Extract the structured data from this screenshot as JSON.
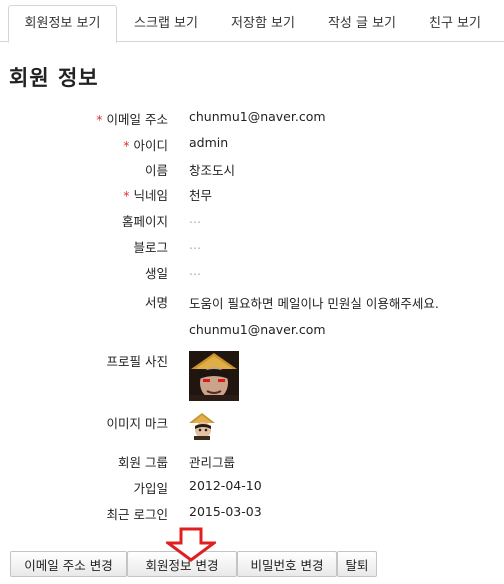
{
  "tabs": [
    {
      "label": "회원정보 보기",
      "active": true
    },
    {
      "label": "스크랩 보기",
      "active": false
    },
    {
      "label": "저장함 보기",
      "active": false
    },
    {
      "label": "작성 글 보기",
      "active": false
    },
    {
      "label": "친구 보기",
      "active": false
    }
  ],
  "page_title": "회원 정보",
  "required_marker": "*",
  "fields": {
    "email": {
      "label": "이메일 주소",
      "value": "chunmu1@naver.com"
    },
    "user_id": {
      "label": "아이디",
      "value": "admin"
    },
    "name": {
      "label": "이름",
      "value": "창조도시"
    },
    "nickname": {
      "label": "닉네임",
      "value": "천무"
    },
    "homepage": {
      "label": "홈페이지",
      "value": "..."
    },
    "blog": {
      "label": "블로그",
      "value": "..."
    },
    "birthday": {
      "label": "생일",
      "value": "..."
    },
    "signature": {
      "label": "서명",
      "line1": "도움이 필요하면 메일이나 민원실 이용해주세요.",
      "line2": "chunmu1@naver.com"
    },
    "profile_photo": {
      "label": "프로필 사진"
    },
    "image_mark": {
      "label": "이미지 마크"
    },
    "group": {
      "label": "회원 그룹",
      "value": "관리그룹"
    },
    "joined": {
      "label": "가입일",
      "value": "2012-04-10"
    },
    "last_login": {
      "label": "최근 로그인",
      "value": "2015-03-03"
    }
  },
  "buttons": {
    "change_email": "이메일 주소 변경",
    "edit_info": "회원정보 변경",
    "change_password": "비밀번호 변경",
    "withdraw": "탈퇴"
  },
  "colors": {
    "required": "#e03030",
    "annotation_arrow": "#e02020",
    "empty_value": "#aaaaaa"
  },
  "icons": {
    "annotation": "down-arrow-outline-icon"
  }
}
